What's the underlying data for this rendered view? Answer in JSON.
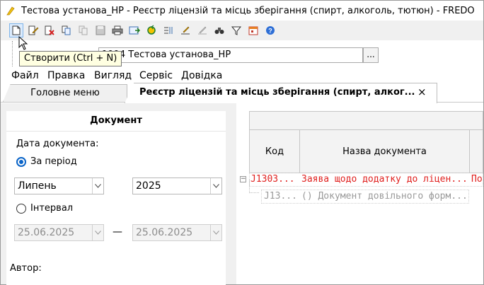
{
  "window": {
    "title": "Тестова установа_НР - Реєстр ліцензій та місць зберігання (спирт, алкоголь, тютюн) - FREDO"
  },
  "toolbar": {
    "buttons": [
      "create",
      "edit",
      "delete",
      "copy",
      "copy-disabled",
      "save",
      "print",
      "export",
      "refresh",
      "columns",
      "edit-field",
      "edit-pencil",
      "find",
      "filter",
      "calendar",
      "help"
    ]
  },
  "tooltip": {
    "text": "Створити (Ctrl + N)"
  },
  "org": {
    "value": "1994  Тестова установа_НР",
    "button_label": "..."
  },
  "menu": [
    "Файл",
    "Правка",
    "Вигляд",
    "Сервіс",
    "Довідка"
  ],
  "tabs": {
    "main": "Головне меню",
    "registry": "Реєстр ліцензій та місць зберігання (спирт, алког...",
    "close_glyph": "×"
  },
  "document_panel": {
    "title": "Документ",
    "date_label": "Дата документа:",
    "period_label": "За період",
    "month_value": "Липень",
    "year_value": "2025",
    "interval_label": "Інтервал",
    "date_from": "25.06.2025",
    "dash": "—",
    "date_to": "25.06.2025",
    "author_label": "Автор:"
  },
  "grid": {
    "columns": [
      "Код",
      "Назва документа"
    ],
    "rows": [
      {
        "code": "J1303...",
        "name": "Заява щодо додатку до ліцен...",
        "extra": "По",
        "color": "#e0201e"
      },
      {
        "code": "J13...",
        "name": "() Документ довільного форм...",
        "extra": "",
        "color": "#9a9a9a"
      }
    ]
  },
  "colors": {
    "accent": "#0a64c8",
    "error_row": "#e0201e"
  }
}
